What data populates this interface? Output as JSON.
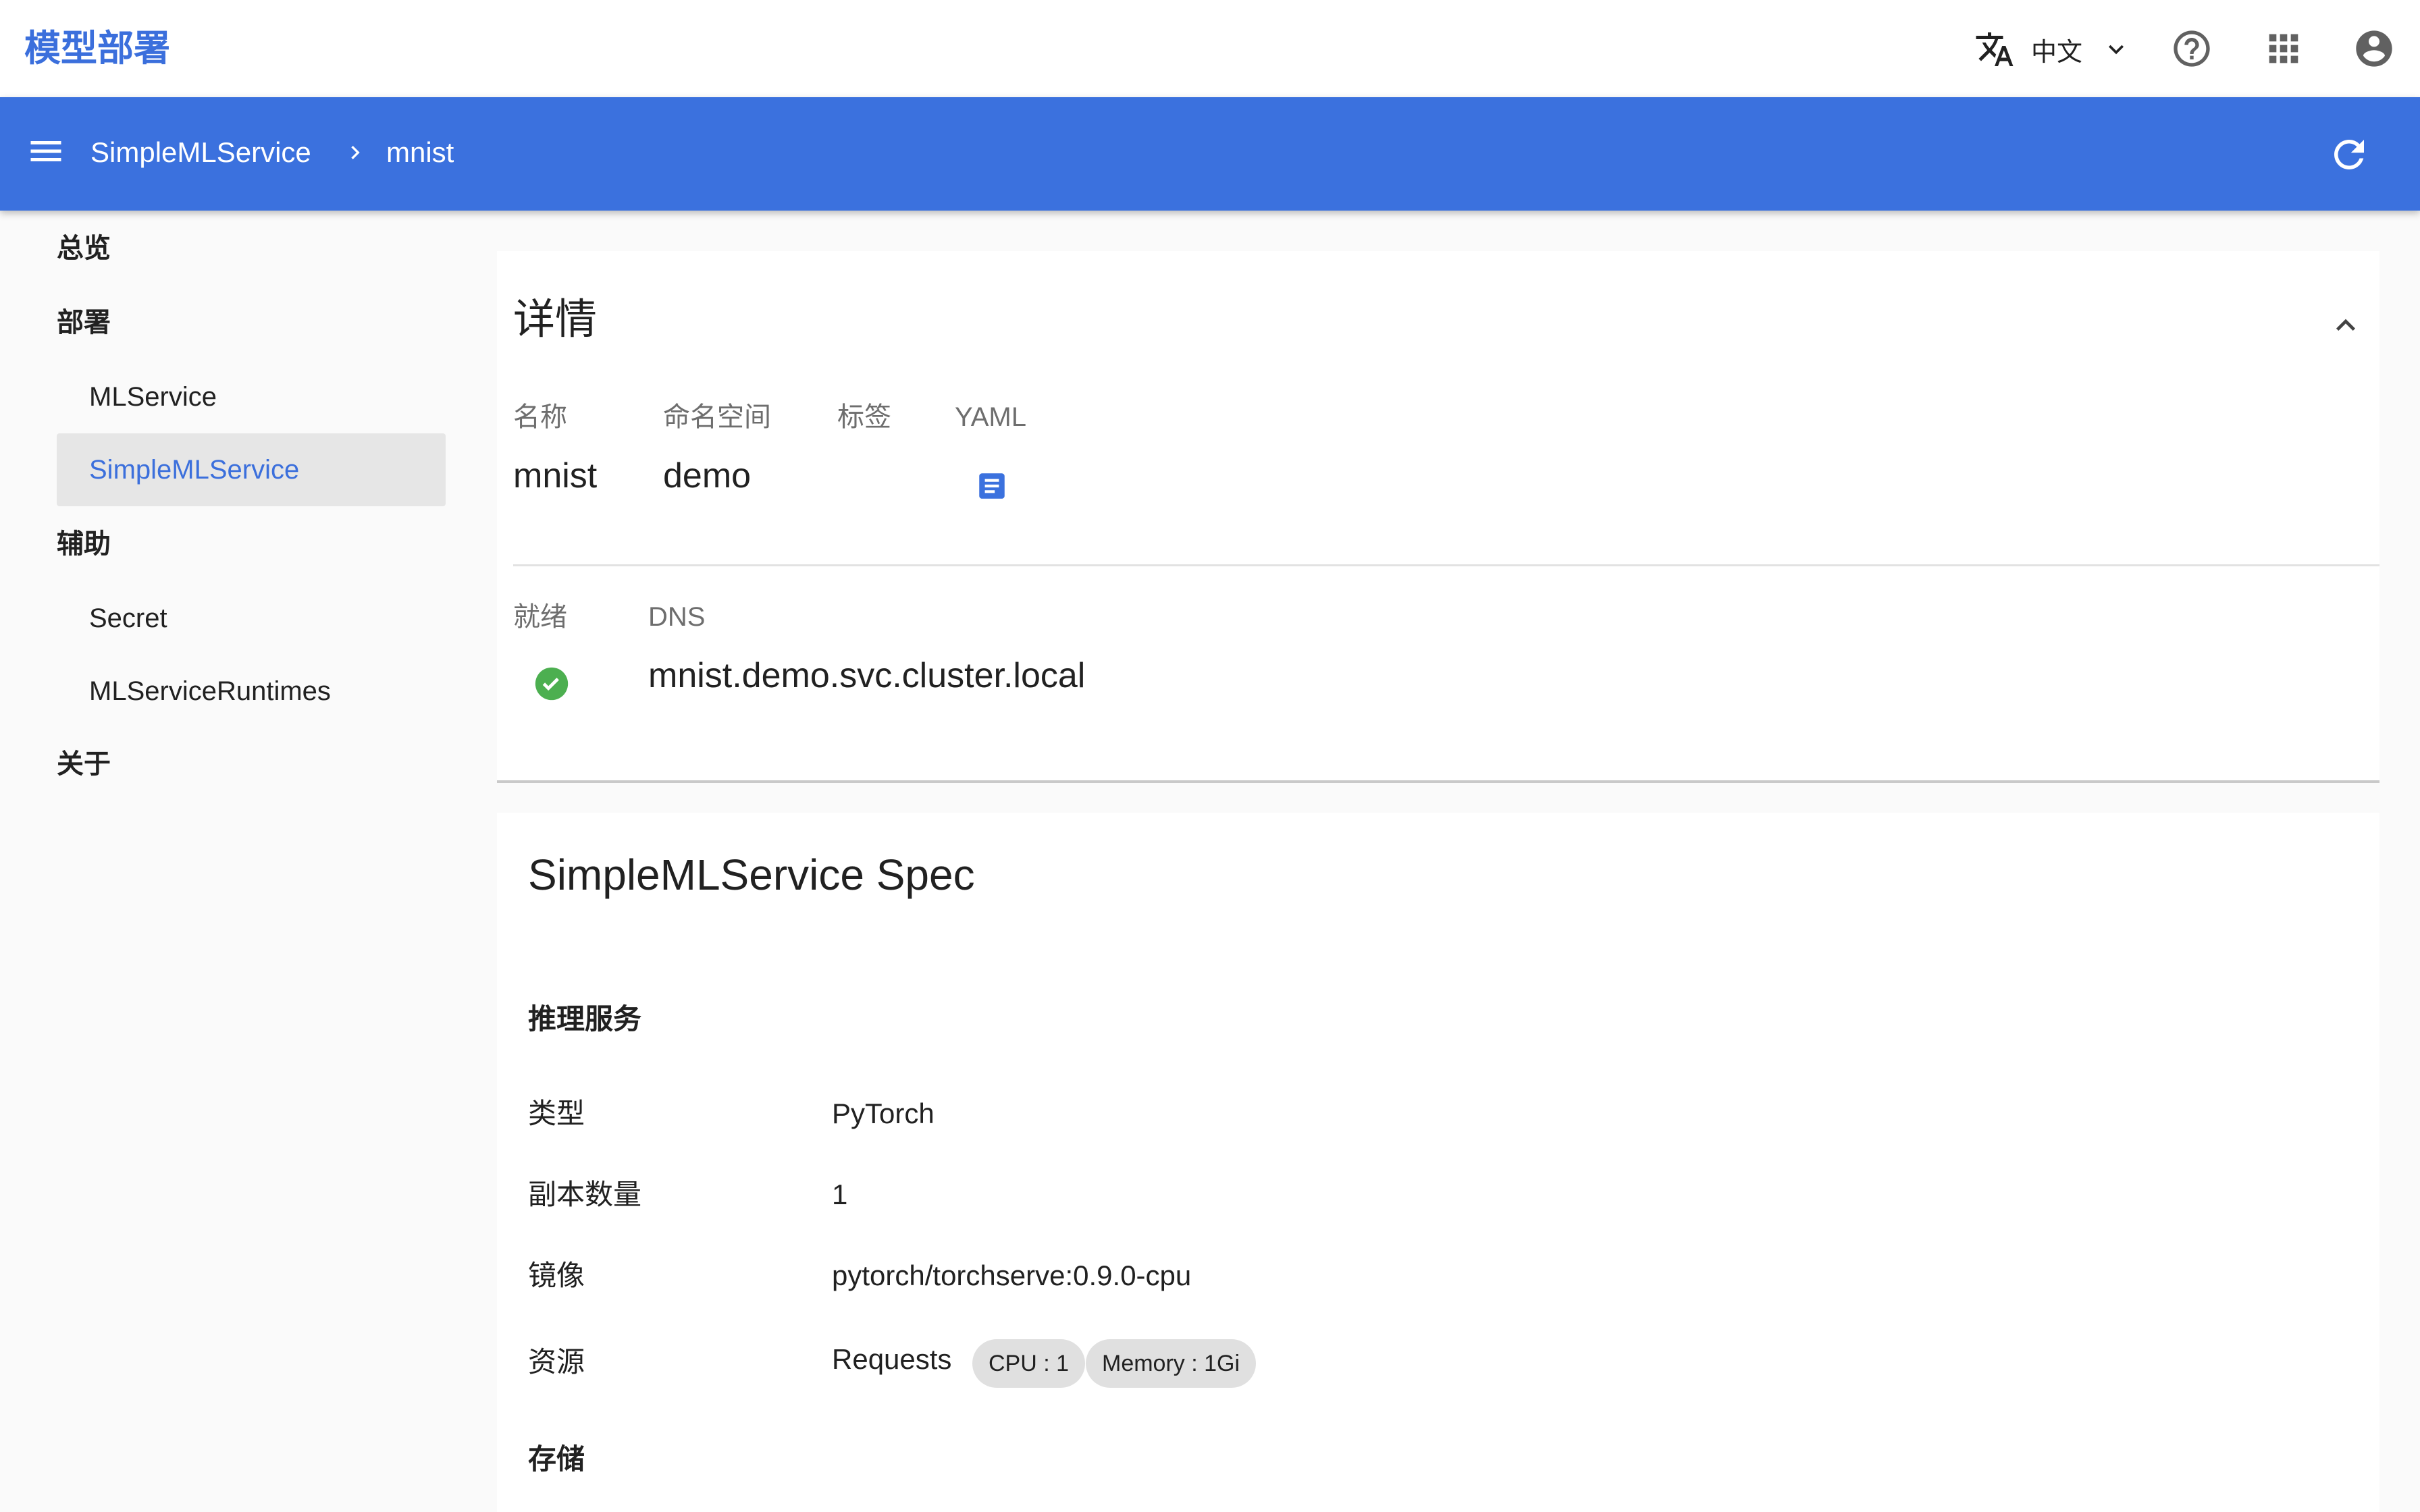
{
  "app": {
    "title": "模型部署",
    "language": "中文"
  },
  "icons": {
    "translate": "translate-icon",
    "language_dropdown": "chevron-down-icon",
    "help": "help-circle-icon",
    "apps": "apps-grid-icon",
    "account": "account-circle-icon",
    "menu": "menu-icon",
    "breadcrumb_separator": "chevron-right-icon",
    "refresh": "refresh-icon",
    "collapse": "chevron-up-icon",
    "yaml": "document-icon",
    "ready": "check-circle-icon"
  },
  "colors": {
    "brand": "#3b6fdc",
    "toolbar": "#3b71de",
    "active_nav_bg": "#e6e6e6",
    "ready_green": "#4caf50",
    "yaml_blue": "#3b71de"
  },
  "breadcrumb": {
    "root": "SimpleMLService",
    "current": "mnist"
  },
  "sidebar": {
    "overview": "总览",
    "deploy_section": "部署",
    "deploy_items": [
      {
        "label": "MLService",
        "active": false
      },
      {
        "label": "SimpleMLService",
        "active": true
      }
    ],
    "aux_section": "辅助",
    "aux_items": [
      {
        "label": "Secret"
      },
      {
        "label": "MLServiceRuntimes"
      }
    ],
    "about": "关于"
  },
  "details": {
    "title": "详情",
    "labels": {
      "name": "名称",
      "namespace": "命名空间",
      "tags": "标签",
      "yaml": "YAML",
      "ready": "就绪",
      "dns": "DNS"
    },
    "name": "mnist",
    "namespace": "demo",
    "ready": true,
    "dns": "mnist.demo.svc.cluster.local"
  },
  "spec": {
    "title": "SimpleMLService Spec",
    "inference_section": "推理服务",
    "rows": [
      {
        "key": "类型",
        "value": "PyTorch"
      },
      {
        "key": "副本数量",
        "value": "1"
      },
      {
        "key": "镜像",
        "value": "pytorch/torchserve:0.9.0-cpu"
      },
      {
        "key": "资源",
        "value": "Requests"
      }
    ],
    "resource_chips": [
      "CPU : 1",
      "Memory : 1Gi"
    ],
    "storage_section": "存储"
  }
}
